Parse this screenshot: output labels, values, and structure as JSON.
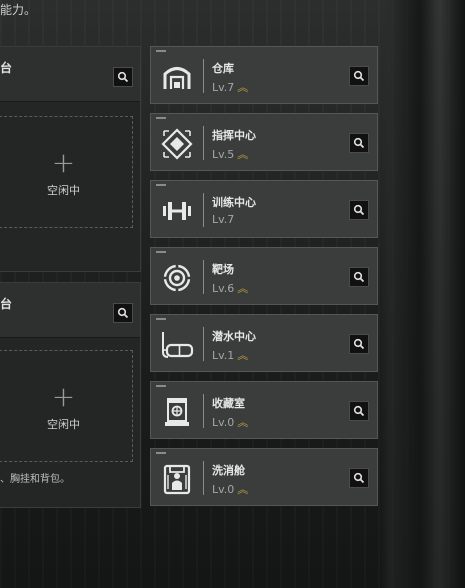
{
  "top_text": "能力。",
  "left_panels": [
    {
      "title": "台",
      "slot_plus": "+",
      "slot_label": "空闲中",
      "note": ""
    },
    {
      "title": "台",
      "slot_plus": "+",
      "slot_label": "空闲中",
      "note": "、胸挂和背包。"
    }
  ],
  "facilities": [
    {
      "name": "仓库",
      "level": "Lv.7",
      "upgrade": "︽",
      "icon": "warehouse-icon"
    },
    {
      "name": "指挥中心",
      "level": "Lv.5",
      "upgrade": "︽",
      "icon": "command-center-icon"
    },
    {
      "name": "训练中心",
      "level": "Lv.7",
      "upgrade": "",
      "icon": "dumbbell-icon"
    },
    {
      "name": "靶场",
      "level": "Lv.6",
      "upgrade": "︽",
      "icon": "target-icon"
    },
    {
      "name": "潜水中心",
      "level": "Lv.1",
      "upgrade": "︽",
      "icon": "diving-mask-icon"
    },
    {
      "name": "收藏室",
      "level": "Lv.0",
      "upgrade": "︽",
      "icon": "collection-icon"
    },
    {
      "name": "洗消舱",
      "level": "Lv.0",
      "upgrade": "︽",
      "icon": "decontamination-icon"
    }
  ]
}
